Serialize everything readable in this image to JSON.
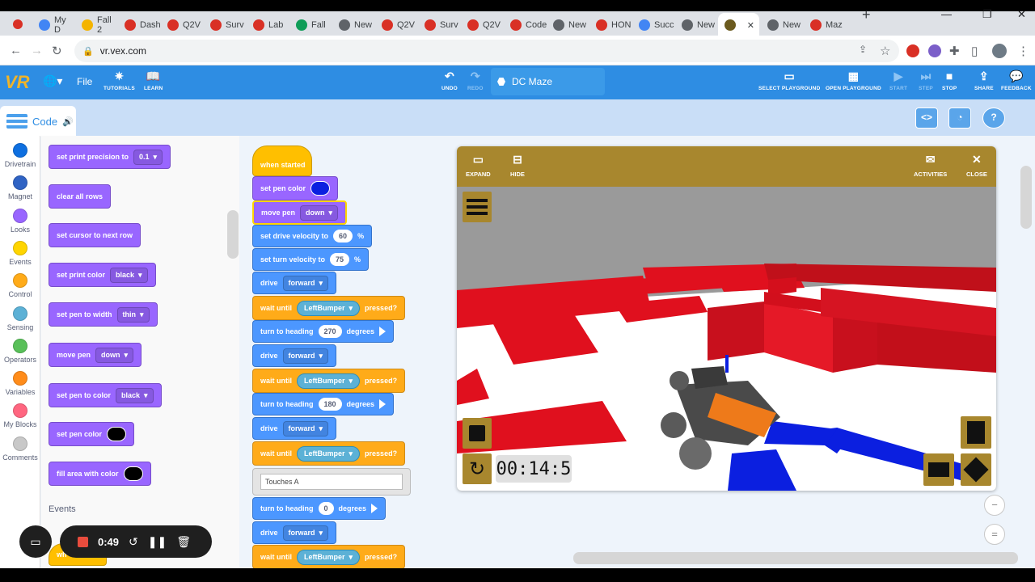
{
  "browser": {
    "tabs": [
      {
        "label": "My D",
        "color": "#4285f4"
      },
      {
        "label": "Fall 2",
        "color": "#f4b400"
      },
      {
        "label": "Dash",
        "color": "#d93025"
      },
      {
        "label": "Q2V",
        "color": "#d93025"
      },
      {
        "label": "Surv",
        "color": "#d93025"
      },
      {
        "label": "Lab",
        "color": "#d93025"
      },
      {
        "label": "Fall",
        "color": "#0f9d58"
      },
      {
        "label": "New",
        "color": "#5f6368"
      },
      {
        "label": "Q2V",
        "color": "#d93025"
      },
      {
        "label": "Surv",
        "color": "#d93025"
      },
      {
        "label": "Q2V",
        "color": "#d93025"
      },
      {
        "label": "Code",
        "color": "#d93025"
      },
      {
        "label": "New",
        "color": "#5f6368"
      },
      {
        "label": "HON",
        "color": "#d93025"
      },
      {
        "label": "Succ",
        "color": "#4285f4"
      },
      {
        "label": "New",
        "color": "#5f6368"
      },
      {
        "label": "",
        "color": "#6b5a1e"
      },
      {
        "label": "New",
        "color": "#5f6368"
      },
      {
        "label": "Maz",
        "color": "#d93025"
      }
    ],
    "url": "vr.vex.com",
    "new_tab": "+",
    "close_tab": "✕"
  },
  "app": {
    "logo": "VR",
    "file_menu": "File",
    "tutorials": "TUTORIALS",
    "learn": "LEARN",
    "undo": "UNDO",
    "redo": "REDO",
    "project_name": "DC Maze",
    "select_playground": "SELECT PLAYGROUND",
    "open_playground": "OPEN PLAYGROUND",
    "start": "START",
    "step": "STEP",
    "stop": "STOP",
    "share": "SHARE",
    "feedback": "FEEDBACK",
    "code_tab": "Code"
  },
  "categories": [
    {
      "label": "Drivetrain",
      "color": "#0e6fe0"
    },
    {
      "label": "Magnet",
      "color": "#2f63c4"
    },
    {
      "label": "Looks",
      "color": "#9966ff"
    },
    {
      "label": "Events",
      "color": "#ffd500"
    },
    {
      "label": "Control",
      "color": "#ffab19"
    },
    {
      "label": "Sensing",
      "color": "#5cb1d6"
    },
    {
      "label": "Operators",
      "color": "#59c059"
    },
    {
      "label": "Variables",
      "color": "#ff8c1a"
    },
    {
      "label": "My Blocks",
      "color": "#ff6680"
    },
    {
      "label": "Comments",
      "color": "#c8c8c8"
    }
  ],
  "palette": {
    "set_print_precision": "set print precision to",
    "precision_value": "0.1",
    "clear_all_rows": "clear all rows",
    "set_cursor_next_row": "set cursor to next row",
    "set_print_color": "set print color",
    "print_color_value": "black",
    "set_pen_width": "set pen to width",
    "pen_width_value": "thin",
    "move_pen": "move pen",
    "move_pen_value": "down",
    "set_pen_to_color": "set pen to color",
    "pen_to_color_value": "black",
    "set_pen_color": "set pen color",
    "fill_area": "fill area with color",
    "events_heading": "Events",
    "partial_event": "wh"
  },
  "script": {
    "when_started": "when started",
    "set_pen_color": "set pen color",
    "move_pen": "move pen",
    "move_pen_value": "down",
    "set_drive_velocity": "set drive velocity to",
    "drive_velocity": "60",
    "set_turn_velocity": "set turn velocity to",
    "turn_velocity": "75",
    "percent": "%",
    "drive": "drive",
    "forward": "forward",
    "wait_until": "wait until",
    "left_bumper": "LeftBumper",
    "pressed": "pressed?",
    "turn_to_heading": "turn to heading",
    "degrees": "degrees",
    "heading_1": "270",
    "heading_2": "180",
    "heading_3": "0",
    "comment_text": "Touches A"
  },
  "playground": {
    "expand": "EXPAND",
    "hide": "HIDE",
    "activities": "ACTIVITIES",
    "close": "CLOSE",
    "timer": "00:14:5"
  },
  "recorder": {
    "elapsed": "0:49"
  },
  "colors": {
    "vex_blue": "#2e8de3",
    "playground_gold": "#a8872e",
    "wall_red": "#e0101e",
    "pen_blue": "#0b1fe0"
  }
}
